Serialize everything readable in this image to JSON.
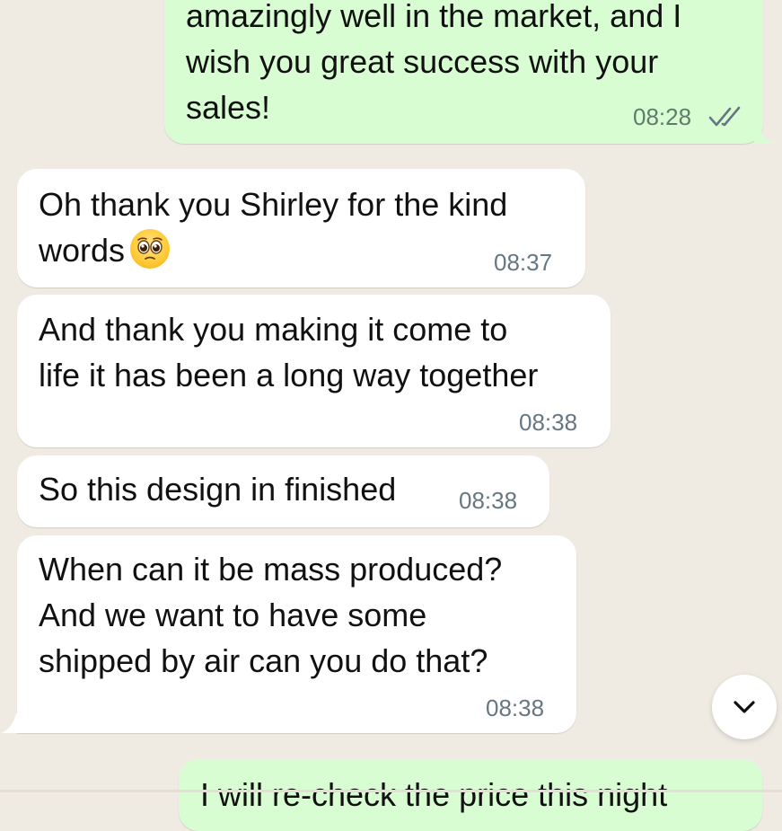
{
  "messages": [
    {
      "direction": "outgoing",
      "lines": [
        "amazingly well in the market, and I",
        "wish you great success with your",
        "sales!"
      ],
      "time": "08:28",
      "status": "read-double-check"
    },
    {
      "direction": "incoming",
      "lines": [
        "Oh thank you Shirley for the kind",
        "words"
      ],
      "emoji": "pleading-face-emoji",
      "time": "08:37"
    },
    {
      "direction": "incoming",
      "lines": [
        "And thank you making it come to",
        "life it has been a long way together"
      ],
      "time": "08:38"
    },
    {
      "direction": "incoming",
      "lines": [
        "So this design in finished"
      ],
      "time": "08:38"
    },
    {
      "direction": "incoming",
      "lines": [
        "When can it be mass produced?",
        "And we want to have some",
        "shipped by air can you do that?"
      ],
      "time": "08:38"
    },
    {
      "direction": "outgoing",
      "lines": [
        "I will re-check the price this night"
      ]
    }
  ],
  "colors": {
    "background": "#efeae2",
    "incoming_bubble": "#ffffff",
    "outgoing_bubble": "#d9fdd3",
    "timestamp": "#667781"
  },
  "scroll_button": {
    "icon": "chevron-down-icon"
  }
}
